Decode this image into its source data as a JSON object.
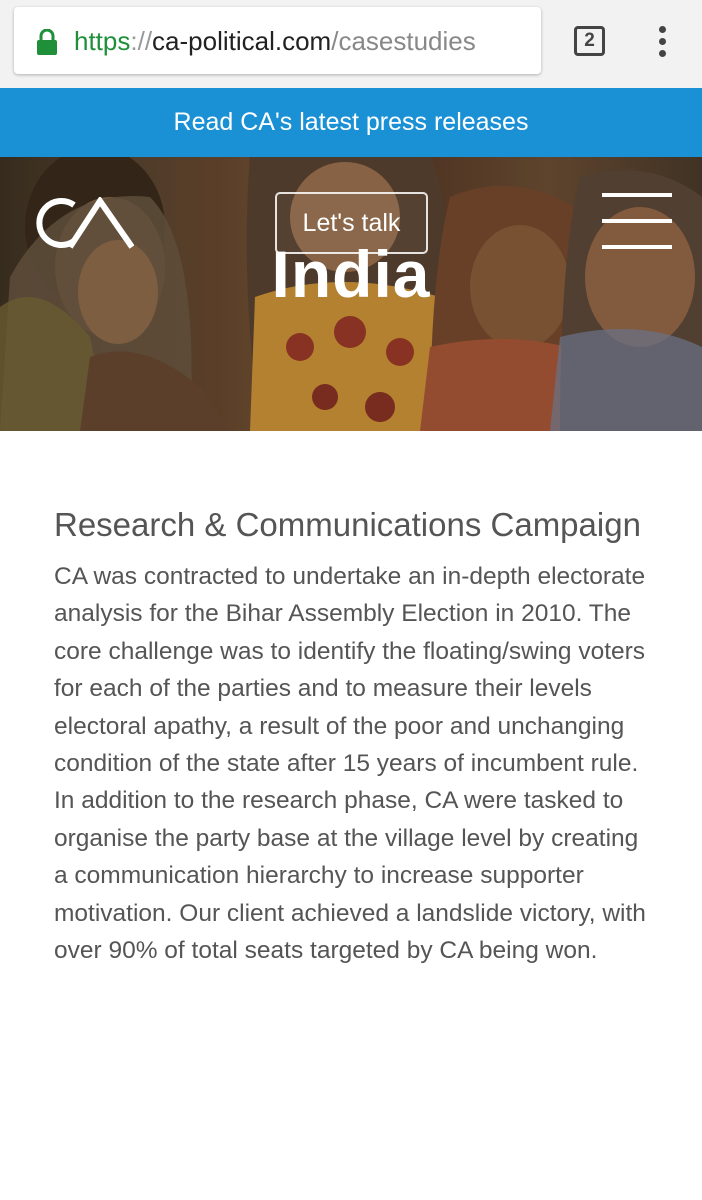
{
  "browser": {
    "url_scheme": "https",
    "url_separator": "://",
    "url_host": "ca-political.com",
    "url_path": "/casestudies",
    "tab_count": "2",
    "lock_icon": "lock-icon",
    "menu_icon": "more-vert-icon"
  },
  "banner": {
    "text": "Read CA's latest press releases",
    "color": "#1a90d5"
  },
  "hero": {
    "logo_text": "CA",
    "button_label": "Let's talk",
    "title": "India",
    "menu_icon": "hamburger-icon"
  },
  "article": {
    "title": "Research & Communications Campaign",
    "body": "CA was contracted to undertake an in-depth electorate analysis for the Bihar Assembly Election in 2010. The core challenge was to identify the floating/swing voters for each of the parties and to measure their levels electoral apathy, a result of the poor and unchanging condition of the state after 15 years of incumbent rule. In addition to the research phase, CA were tasked to organise the party base at the village level by creating a communication hierarchy to increase supporter motivation. Our client achieved a landslide victory, with over 90% of total seats targeted by CA being won."
  }
}
